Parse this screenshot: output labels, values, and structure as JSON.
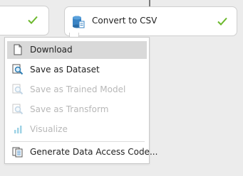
{
  "canvas": {
    "module_convert": {
      "title": "Convert to CSV",
      "status_icon": "check-icon",
      "module_icon": "database-icon"
    },
    "module_left": {
      "status_icon": "check-icon"
    }
  },
  "context_menu": {
    "items": [
      {
        "label": "Download",
        "icon": "document-icon",
        "enabled": true,
        "highlighted": true
      },
      {
        "label": "Save as Dataset",
        "icon": "magnifier-icon",
        "enabled": true,
        "highlighted": false
      },
      {
        "label": "Save as Trained Model",
        "icon": "magnifier-icon",
        "enabled": false,
        "highlighted": false
      },
      {
        "label": "Save as Transform",
        "icon": "magnifier-icon",
        "enabled": false,
        "highlighted": false
      },
      {
        "label": "Visualize",
        "icon": "bar-chart-icon",
        "enabled": false,
        "highlighted": false
      },
      {
        "label": "Generate Data Access Code...",
        "icon": "documents-icon",
        "enabled": true,
        "highlighted": false
      }
    ]
  },
  "colors": {
    "check": "#6bb82c",
    "highlight": "#d9d9d9",
    "disabled_text": "#b8b8b8",
    "magnifier": "#2f7fb5",
    "database": "#3a84c4"
  }
}
